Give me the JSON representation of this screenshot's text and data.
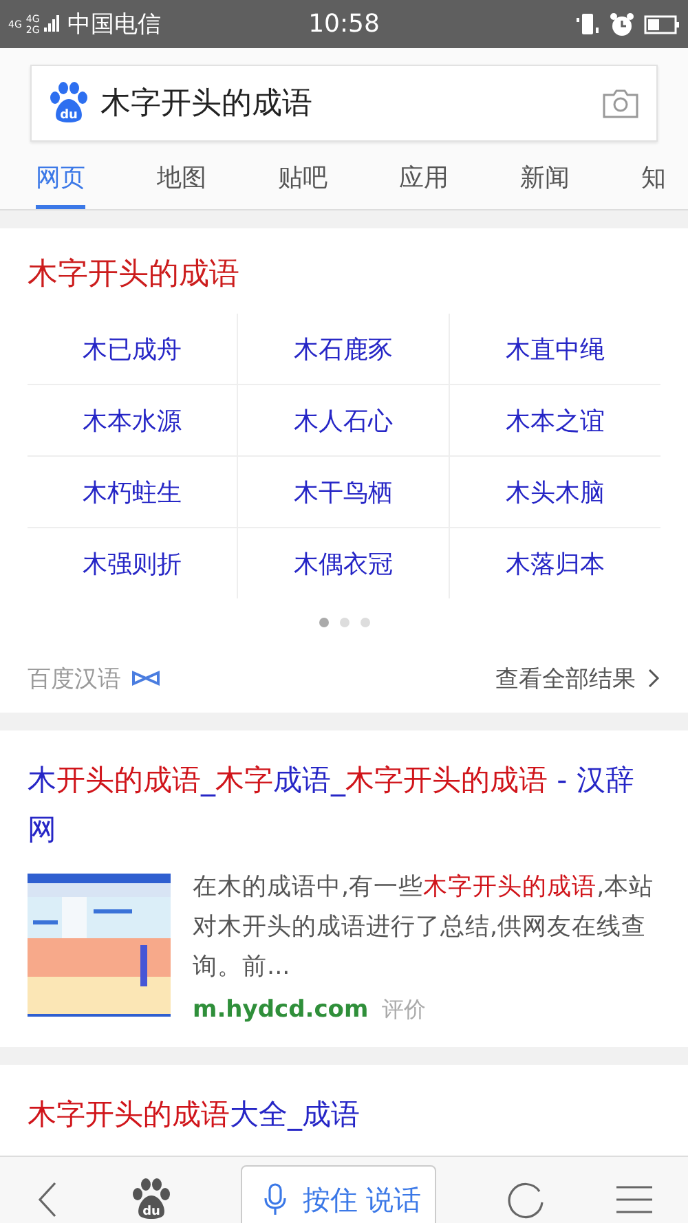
{
  "status_bar": {
    "network_labels": [
      "4G",
      "4G",
      "2G"
    ],
    "carrier": "中国电信",
    "time": "10:58"
  },
  "search": {
    "logo_text": "du",
    "value": "木字开头的成语"
  },
  "tabs": [
    {
      "label": "网页",
      "selected": true
    },
    {
      "label": "地图",
      "selected": false
    },
    {
      "label": "贴吧",
      "selected": false
    },
    {
      "label": "应用",
      "selected": false
    },
    {
      "label": "新闻",
      "selected": false
    },
    {
      "label": "知",
      "selected": false
    }
  ],
  "idiom_card": {
    "title": "木字开头的成语",
    "idioms": [
      "木已成舟",
      "木石鹿豕",
      "木直中绳",
      "木本水源",
      "木人石心",
      "木本之谊",
      "木朽蛀生",
      "木干鸟栖",
      "木头木脑",
      "木强则折",
      "木偶衣冠",
      "木落归本"
    ],
    "pages": [
      {
        "selected": true
      },
      {
        "selected": false
      },
      {
        "selected": false
      }
    ],
    "source": "百度汉语",
    "more": "查看全部结果"
  },
  "results": [
    {
      "title": [
        {
          "text": "木",
          "highlight": false
        },
        {
          "text": "开头的成语",
          "highlight": true
        },
        {
          "text": "_",
          "highlight": false
        },
        {
          "text": "木字",
          "highlight": true
        },
        {
          "text": "成语_",
          "highlight": false
        },
        {
          "text": "木字开头的成语",
          "highlight": true
        },
        {
          "text": " - 汉辞网",
          "highlight": false
        }
      ],
      "snippet": [
        {
          "text": "在木的成语中,有一些",
          "highlight": false
        },
        {
          "text": "木字开头的成语",
          "highlight": true
        },
        {
          "text": ",本站对木开头的成语进行了总结,供网友在线查询。前...",
          "highlight": false
        }
      ],
      "url": "m.hydcd.com",
      "rate": "评价"
    },
    {
      "title": [
        {
          "text": "木字开头的成语",
          "highlight": true
        },
        {
          "text": "大全_成语",
          "highlight": false
        }
      ]
    }
  ],
  "bottom_bar": {
    "logo_text": "du",
    "voice_label": "按住 说话"
  }
}
